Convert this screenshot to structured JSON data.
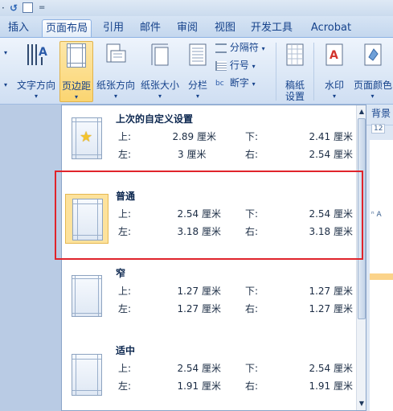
{
  "quick_access": {
    "undo_glyph": "·",
    "redo_glyph": "↺",
    "customize_glyph": "="
  },
  "tabs": [
    {
      "label": "插入",
      "active": false
    },
    {
      "label": "页面布局",
      "active": true
    },
    {
      "label": "引用",
      "active": false
    },
    {
      "label": "邮件",
      "active": false
    },
    {
      "label": "审阅",
      "active": false
    },
    {
      "label": "视图",
      "active": false
    },
    {
      "label": "开发工具",
      "active": false
    },
    {
      "label": "Acrobat",
      "active": false
    }
  ],
  "ribbon": {
    "text_direction": "文字方向",
    "margins": "页边距",
    "orientation": "纸张方向",
    "size": "纸张大小",
    "columns": "分栏",
    "breaks": "分隔符",
    "line_numbers": "行号",
    "hyphenation": "断字",
    "draft_paper_line1": "稿纸",
    "draft_paper_line2": "设置",
    "watermark": "水印",
    "page_color": "页面颜色"
  },
  "right_doc": {
    "background_tab": "背景",
    "ruler": "12"
  },
  "margins_dropdown": {
    "labels": {
      "top": "上:",
      "bottom": "下:",
      "left": "左:",
      "right": "右:"
    },
    "presets": [
      {
        "name": "上次的自定义设置",
        "top": "2.89 厘米",
        "bottom": "2.41 厘米",
        "left": "3 厘米",
        "right": "2.54 厘米",
        "icon": "star-icon"
      },
      {
        "name": "普通",
        "top": "2.54 厘米",
        "bottom": "2.54 厘米",
        "left": "3.18 厘米",
        "right": "3.18 厘米",
        "selected": true
      },
      {
        "name": "窄",
        "top": "1.27 厘米",
        "bottom": "1.27 厘米",
        "left": "1.27 厘米",
        "right": "1.27 厘米"
      },
      {
        "name": "适中",
        "top": "2.54 厘米",
        "bottom": "2.54 厘米",
        "left": "1.91 厘米",
        "right": "1.91 厘米"
      }
    ]
  },
  "colors": {
    "highlight": "#fbd571",
    "annotation": "#e0242b",
    "ribbon_text": "#15428b"
  }
}
